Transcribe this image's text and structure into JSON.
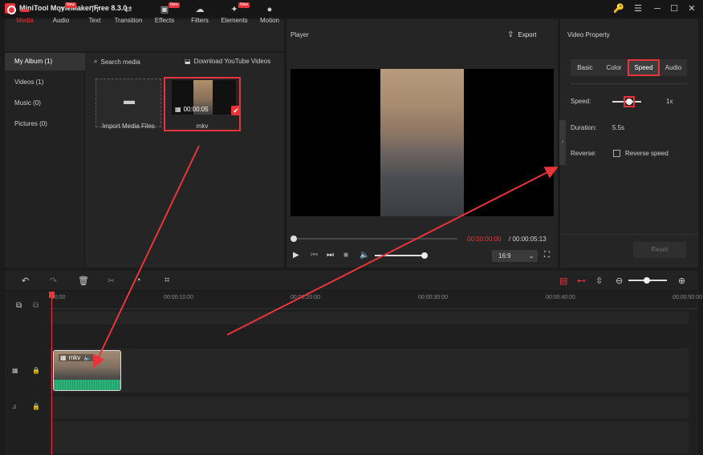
{
  "app": {
    "title": "MiniTool MovieMaker Free 8.3.0"
  },
  "window_controls": {
    "key": "🔑",
    "menu": "☰",
    "minimize": "─",
    "maximize": "☐",
    "close": "✕"
  },
  "toolbar": {
    "items": [
      {
        "label": "Media",
        "icon": "folder-icon",
        "glyph": "▬",
        "new": false
      },
      {
        "label": "Audio",
        "icon": "music-icon",
        "glyph": "♫",
        "new": true
      },
      {
        "label": "Text",
        "icon": "text-icon",
        "glyph": "Tт",
        "new": false
      },
      {
        "label": "Transition",
        "icon": "transition-icon",
        "glyph": "⇄",
        "new": false
      },
      {
        "label": "Effects",
        "icon": "effects-icon",
        "glyph": "▣",
        "new": true
      },
      {
        "label": "Filters",
        "icon": "filters-icon",
        "glyph": "☁",
        "new": false
      },
      {
        "label": "Elements",
        "icon": "elements-icon",
        "glyph": "✦",
        "new": true
      },
      {
        "label": "Motion",
        "icon": "motion-icon",
        "glyph": "●",
        "new": false
      }
    ],
    "new_badge": "New"
  },
  "album": {
    "items": [
      "My Album (1)",
      "Videos (1)",
      "Music (0)",
      "Pictures (0)"
    ]
  },
  "media": {
    "search": "Search media",
    "download": "Download YouTube Videos",
    "import_label": "Import Media Files",
    "item": {
      "duration": "00:00:05",
      "name": "mkv"
    }
  },
  "player": {
    "title": "Player",
    "export": "Export",
    "time_current": "00:00:00:00",
    "time_total": "/ 00:00:05:13",
    "ratio": "16:9"
  },
  "properties": {
    "title": "Video Property",
    "tabs": [
      "Basic",
      "Color",
      "Speed",
      "Audio"
    ],
    "speed_label": "Speed:",
    "speed_value": "1x",
    "duration_label": "Duration:",
    "duration_value": "5.5s",
    "reverse_label": "Reverse:",
    "reverse_option": "Reverse speed",
    "reset": "Reset"
  },
  "timeline": {
    "ticks": [
      "00:00",
      "00:00:10:00",
      "00:00:20:00",
      "00:00:30:00",
      "00:00:40:00",
      "00:00:50:00"
    ],
    "clip_label": "mkv"
  }
}
